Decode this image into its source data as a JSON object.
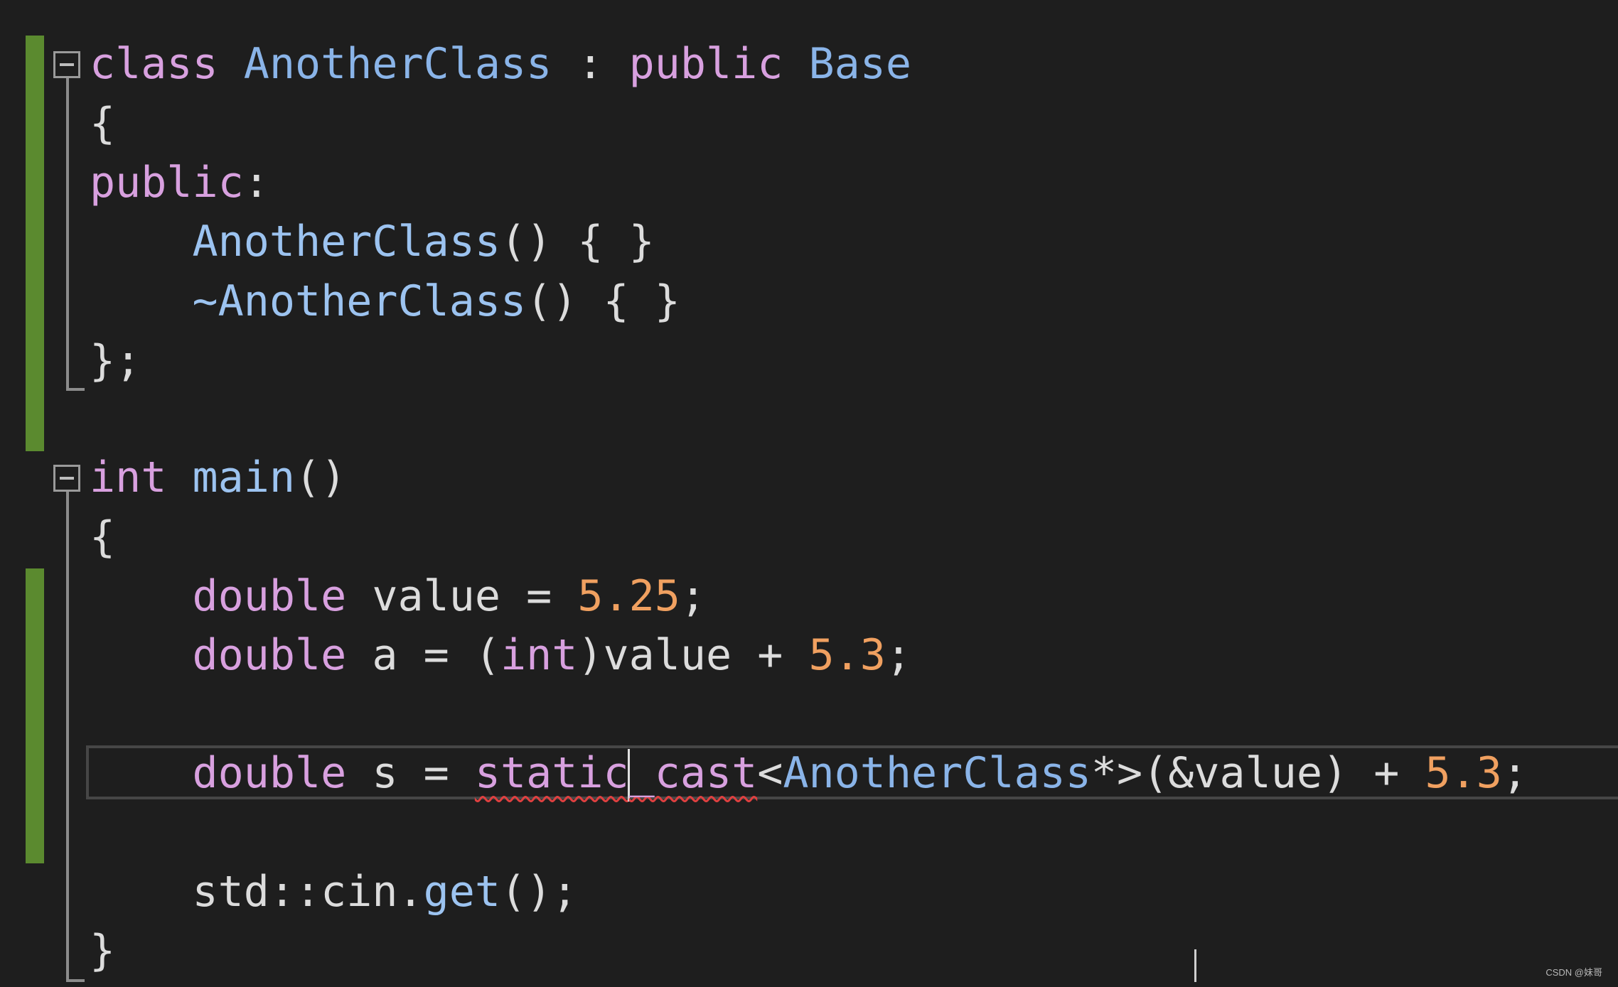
{
  "code": {
    "class_block": {
      "line1": {
        "kw_class": "class",
        "class_name": "AnotherClass",
        "colon": " : ",
        "kw_public": "public",
        "base_name": "Base"
      },
      "line2": {
        "brace_open": "{"
      },
      "line3": {
        "access": "public",
        "colon": ":"
      },
      "line4": {
        "ctor_name": "AnotherClass",
        "ctor_body": "() { }"
      },
      "line5": {
        "dtor_name": "~AnotherClass",
        "dtor_body": "() { }"
      },
      "line6": {
        "brace_close": "};"
      }
    },
    "main_block": {
      "line1": {
        "kw_int": "int",
        "fn_name": "main",
        "parens": "()"
      },
      "line2": {
        "brace_open": "{"
      },
      "line3": {
        "type": "double",
        "decl": " value = ",
        "number": "5.25",
        "end": ";"
      },
      "line4": {
        "type": "double",
        "decl": " a = (",
        "cast_type": "int",
        "expr": ")value + ",
        "number": "5.3",
        "end": ";"
      },
      "line5": {
        "type": "double",
        "decl": " s = ",
        "cast_a": "static",
        "cast_b": "_cast",
        "lt": "<",
        "target_type": "AnotherClass",
        "target_rest": "*>(&value) + ",
        "number": "5.3",
        "end": ";"
      },
      "line6": {
        "ns": "std::cin.",
        "fn_get": "get",
        "call_end": "();"
      },
      "line7": {
        "brace_close": "}"
      }
    }
  },
  "watermark": "CSDN @妹哥",
  "colors": {
    "background": "#1e1e1e",
    "keyword_purple": "#d8a0df",
    "type_blue": "#8ab4e8",
    "number_orange": "#f0a060",
    "change_bar_green": "#5b8a2f",
    "error_squiggle": "#e04040"
  }
}
